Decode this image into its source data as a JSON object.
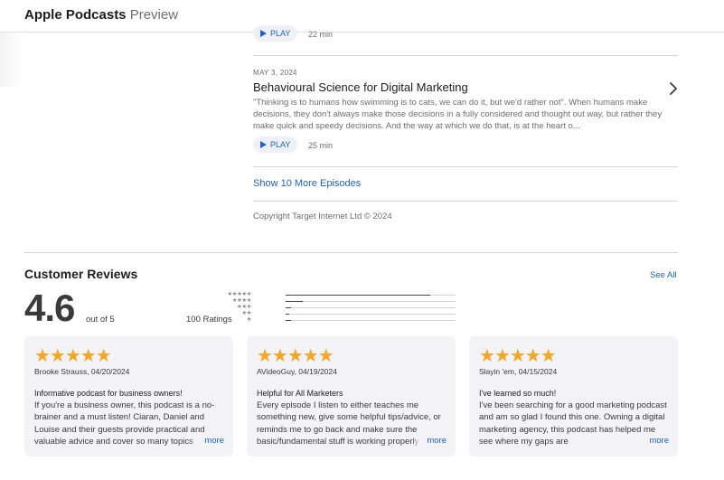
{
  "header": {
    "brand_bold": "Apple Podcasts",
    "brand_light": "Preview"
  },
  "episodes": [
    {
      "play_label": "PLAY",
      "duration": "22 min"
    },
    {
      "date": "MAY 3, 2024",
      "title": "Behavioural Science for Digital Marketing",
      "description": "\"Thinking is to humans how swimming is to cats, we can do it, but we'd rather not\". When humans make decisions, they don't always make those decisions in a fully considered and thought out way, but rather they make quick and speedy decisions. And the way at which we do that, is at the heart o...",
      "play_label": "PLAY",
      "duration": "25 min"
    }
  ],
  "show_more": "Show 10 More Episodes",
  "copyright": "Copyright Target Internet Ltd © 2024",
  "reviews": {
    "heading": "Customer Reviews",
    "see_all": "See All",
    "average": "4.6",
    "out_of": "out of 5",
    "count": "100 Ratings",
    "distribution": [
      {
        "stars": "★★★★★",
        "fraction": 0.85
      },
      {
        "stars": "★★★★",
        "fraction": 0.1
      },
      {
        "stars": "★★★",
        "fraction": 0.03
      },
      {
        "stars": "★★",
        "fraction": 0.02
      },
      {
        "stars": "★",
        "fraction": 0.03
      }
    ],
    "cards": [
      {
        "stars": "★★★★★",
        "meta": "Brooke Strauss, 04/20/2024",
        "title": "Informative podcast for business owners!",
        "body": "If you're a business owner, this podcast is a no-brainer and a must listen! Ciaran, Daniel and Louise and their guests provide practical and valuable advice and cover so many topics",
        "more": "more"
      },
      {
        "stars": "★★★★★",
        "meta": "AVideoGuy, 04/19/2024",
        "title": "Helpful for All Marketers",
        "body": "Every episode I listen to either teaches me something new, give some helpful tips/advice, or reminds me to go back and make sure the basic/fundamental stuff is working properly",
        "more": "more"
      },
      {
        "stars": "★★★★★",
        "meta": "Slayin 'em, 04/15/2024",
        "title": "I've learned so much!",
        "body": "I've been searching for a good marketing podcast and am so glad I found this one. Owning a digital marketing agency, this podcast has helped me see where my gaps are",
        "more": "more"
      }
    ]
  },
  "colors": {
    "accent": "#1a63c9",
    "star": "#f5a623",
    "card_bg": "#f2f2f7"
  }
}
